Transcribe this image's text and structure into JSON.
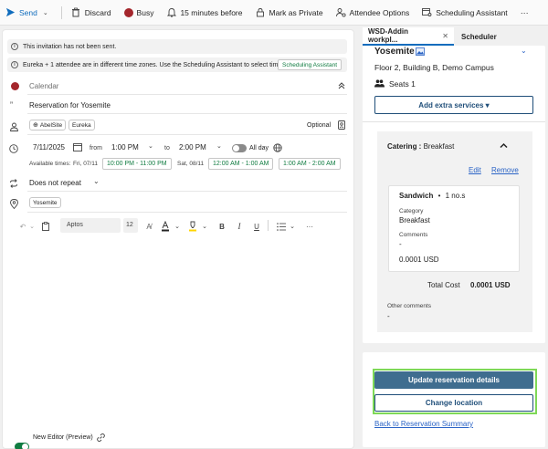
{
  "toolbar": {
    "send": "Send",
    "discard": "Discard",
    "busy": "Busy",
    "reminder": "15 minutes before",
    "private": "Mark as Private",
    "attendee_options": "Attendee Options",
    "scheduling_assistant": "Scheduling Assistant",
    "more": "···",
    "busy_color": "#a4262c"
  },
  "banners": {
    "not_sent": "This invitation has not been sent.",
    "timezone": "Eureka + 1 attendee are in different time zones. Use the Scheduling Assistant to select times...",
    "sa_button": "Scheduling Assistant"
  },
  "event": {
    "calendar_placeholder": "Calendar",
    "title": "Reservation for Yosemite",
    "attendees": [
      "AbelSite",
      "Eureka"
    ],
    "optional": "Optional",
    "date": "7/11/2025",
    "from_label": "from",
    "start": "1:00 PM",
    "to_label": "to",
    "end": "2:00 PM",
    "all_day": "All day",
    "available_label": "Available times:",
    "avail_day1": "Fri, 07/11",
    "avail_slot1": "10:00 PM - 11:00 PM",
    "avail_day2": "Sat, 08/11",
    "avail_slot2": "12:00 AM - 1:00 AM",
    "avail_slot3": "1:00 AM - 2:00 AM",
    "repeat": "Does not repeat",
    "location_chip": "Yosemite"
  },
  "format": {
    "font": "Aptos",
    "size": "12",
    "more": "···"
  },
  "footer": {
    "new_editor": "New Editor (Preview)"
  },
  "addin": {
    "tab_active": "WSD-Addin workpl...",
    "tab_other": "Scheduler",
    "room_name": "Yosemite",
    "room_location": "Floor 2, Building B, Demo Campus",
    "seats": "Seats 1",
    "add_services": "Add extra services ▾",
    "catering_label": "Catering :",
    "catering_type": "Breakfast",
    "edit": "Edit",
    "remove": "Remove",
    "item_name": "Sandwich",
    "item_qty": "1 no.s",
    "category_label": "Category",
    "category_value": "Breakfast",
    "comments_label": "Comments",
    "comments_value": "-",
    "price": "0.0001 USD",
    "total_label": "Total Cost",
    "total_value": "0.0001 USD",
    "other_comments_label": "Other comments",
    "other_comments_value": "-",
    "update_button": "Update reservation details",
    "change_location": "Change location",
    "back_link": "Back to Reservation Summary",
    "accent": "#2b64c6",
    "highlight": "#7ed957"
  }
}
